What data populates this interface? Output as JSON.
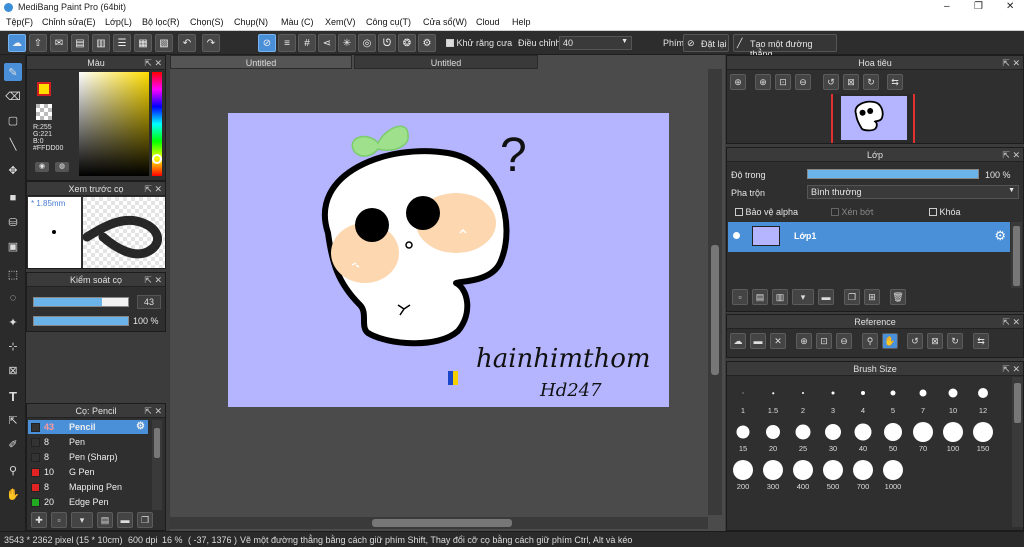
{
  "app": {
    "title": "MediBang Paint Pro (64bit)",
    "window_controls": [
      "–",
      "❐",
      "✕"
    ]
  },
  "menu": [
    "Tệp(F)",
    "Chỉnh sửa(E)",
    "Lớp(L)",
    "Bộ lọc(R)",
    "Chọn(S)",
    "Chụp(N)",
    "Màu (C)",
    "Xem(V)",
    "Công cụ(T)",
    "Cửa sổ(W)",
    "Cloud",
    "Help"
  ],
  "toolbar": {
    "antialias_label": "Khử răng cưa",
    "adjust_label": "Điều chỉnh",
    "adjust_value": "40",
    "pen_label": "Phím",
    "reset_label": "Đặt lại",
    "make_line_label": "Tạo một đường thẳng"
  },
  "color_panel": {
    "title": "Màu",
    "r": "R:255",
    "g": "G:221",
    "b": "B:0",
    "hex": "#FFDD00",
    "fg_color": "#FFDD00",
    "bg_color": "#FFFFFF"
  },
  "preview_panel": {
    "title": "Xem trước cọ",
    "size": "* 1.85mm"
  },
  "brush_control": {
    "title": "Kiểm soát cọ",
    "size_value": "43",
    "size_fraction": 0.72,
    "opacity_value": "100 %",
    "opacity_fraction": 1.0
  },
  "brush_list": {
    "title": "Cọ: Pencil",
    "items": [
      {
        "size": "43",
        "name": "Pencil",
        "color": "#333333",
        "selected": true
      },
      {
        "size": "8",
        "name": "Pen",
        "color": "#333333"
      },
      {
        "size": "8",
        "name": "Pen (Sharp)",
        "color": "#333333"
      },
      {
        "size": "10",
        "name": "G Pen",
        "color": "#e02424"
      },
      {
        "size": "8",
        "name": "Mapping Pen",
        "color": "#e02424"
      },
      {
        "size": "20",
        "name": "Edge Pen",
        "color": "#22aa22"
      }
    ]
  },
  "tabs": [
    "Untitled",
    "Untitled"
  ],
  "canvas": {
    "signature": "hainhimthom",
    "signature2": "Hd247",
    "question": "?"
  },
  "navigator": {
    "title": "Hoa tiêu"
  },
  "layer_panel": {
    "title": "Lớp",
    "opacity_label": "Độ trong",
    "opacity_value": "100 %",
    "opacity_fraction": 1.0,
    "blend_label": "Pha trộn",
    "blend_value": "Bình thường",
    "protect_alpha": "Bảo vệ alpha",
    "clipping": "Xén bớt",
    "lock": "Khóa",
    "layers": [
      {
        "name": "Lớp1"
      }
    ]
  },
  "reference": {
    "title": "Reference"
  },
  "brush_size": {
    "title": "Brush Size",
    "sizes": [
      "1",
      "1.5",
      "2",
      "3",
      "4",
      "5",
      "7",
      "10",
      "12",
      "15",
      "20",
      "25",
      "30",
      "40",
      "50",
      "70",
      "100",
      "150",
      "200",
      "300",
      "400",
      "500",
      "700",
      "1000"
    ]
  },
  "status": {
    "dimensions": "3543 * 2362 pixel",
    "size_cm": "(15 * 10cm)",
    "dpi": "600 dpi",
    "zoom": "16 %",
    "coords": "( -37, 1376 )",
    "hint": "Vẽ một đường thẳng bằng cách giữ phím Shift, Thay đổi cỡ cọ bằng cách giữ phím Ctrl, Alt và kéo"
  }
}
